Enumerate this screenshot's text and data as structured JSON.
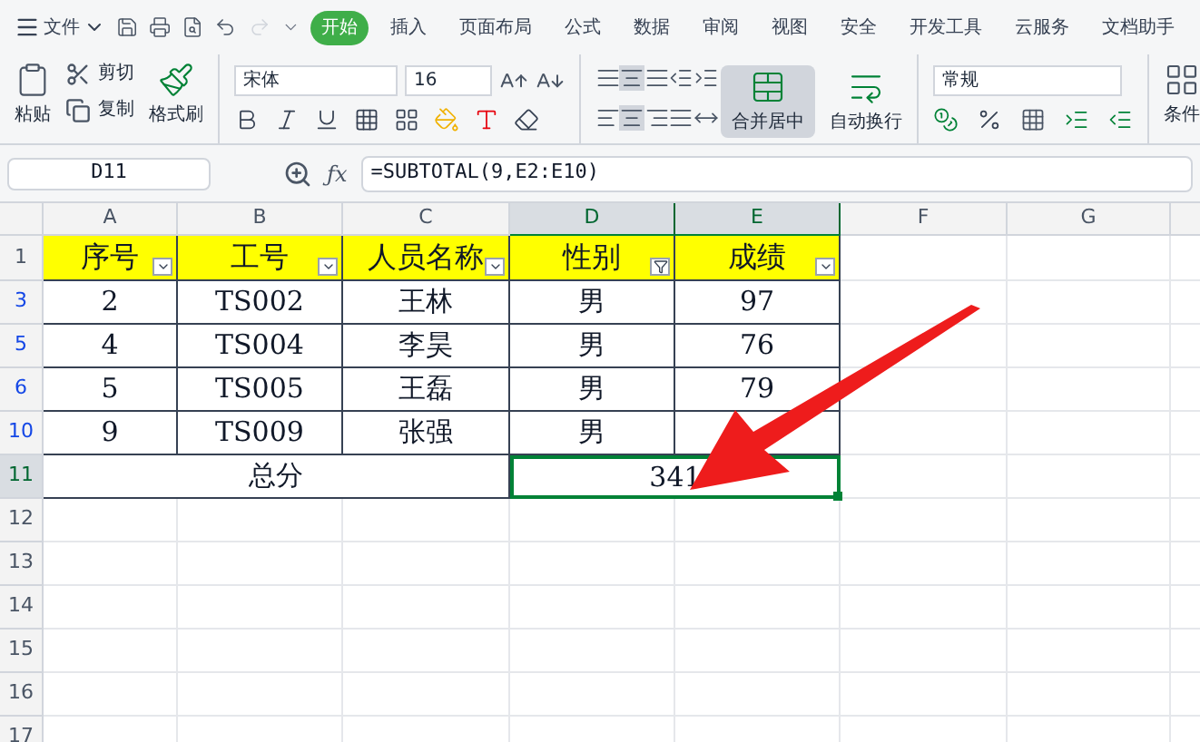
{
  "menu": {
    "file": "文件",
    "tabs": [
      {
        "label": "开始",
        "selected": true
      },
      {
        "label": "插入",
        "selected": false
      },
      {
        "label": "页面布局",
        "selected": false
      },
      {
        "label": "公式",
        "selected": false
      },
      {
        "label": "数据",
        "selected": false
      },
      {
        "label": "审阅",
        "selected": false
      },
      {
        "label": "视图",
        "selected": false
      },
      {
        "label": "安全",
        "selected": false
      },
      {
        "label": "开发工具",
        "selected": false
      },
      {
        "label": "云服务",
        "selected": false
      },
      {
        "label": "文档助手",
        "selected": false
      }
    ]
  },
  "ribbon": {
    "paste": "粘贴",
    "cut": "剪切",
    "copy": "复制",
    "format_painter": "格式刷",
    "font": "宋体",
    "font_size": "16",
    "merge": {
      "label": "合并居中",
      "selected": true
    },
    "wrap": "自动换行",
    "number_format": "常规",
    "conditional": "条件"
  },
  "formula_bar": {
    "name_box": "D11",
    "fx": "ƒx",
    "formula": "=SUBTOTAL(9,E2:E10)"
  },
  "columns": [
    {
      "label": "A",
      "selected": false
    },
    {
      "label": "B",
      "selected": false
    },
    {
      "label": "C",
      "selected": false
    },
    {
      "label": "D",
      "selected": true
    },
    {
      "label": "E",
      "selected": true
    },
    {
      "label": "F",
      "selected": false
    },
    {
      "label": "G",
      "selected": false
    }
  ],
  "rows": [
    {
      "number": "1",
      "kind": "header",
      "selected": false,
      "cells": [
        {
          "text": "序号",
          "filtered": false
        },
        {
          "text": "工号",
          "filtered": false
        },
        {
          "text": "人员名称",
          "filtered": false
        },
        {
          "text": "性别",
          "filtered": true
        },
        {
          "text": "成绩",
          "filtered": false
        }
      ]
    },
    {
      "number": "3",
      "kind": "data",
      "selected": false,
      "cells": [
        "2",
        "TS002",
        "王林",
        "男",
        "97"
      ]
    },
    {
      "number": "5",
      "kind": "data",
      "selected": false,
      "cells": [
        "4",
        "TS004",
        "李昊",
        "男",
        "76"
      ]
    },
    {
      "number": "6",
      "kind": "data",
      "selected": false,
      "cells": [
        "5",
        "TS005",
        "王磊",
        "男",
        "79"
      ]
    },
    {
      "number": "10",
      "kind": "data",
      "selected": false,
      "cells": [
        "9",
        "TS009",
        "张强",
        "男"
      ]
    },
    {
      "number": "11",
      "kind": "total",
      "selected": true,
      "label": "总分",
      "value": "341"
    },
    {
      "number": "12",
      "kind": "empty",
      "selected": false
    },
    {
      "number": "13",
      "kind": "empty",
      "selected": false
    },
    {
      "number": "14",
      "kind": "empty",
      "selected": false
    },
    {
      "number": "15",
      "kind": "empty",
      "selected": false
    },
    {
      "number": "16",
      "kind": "empty",
      "selected": false
    },
    {
      "number": "17",
      "kind": "empty",
      "selected": false
    }
  ]
}
